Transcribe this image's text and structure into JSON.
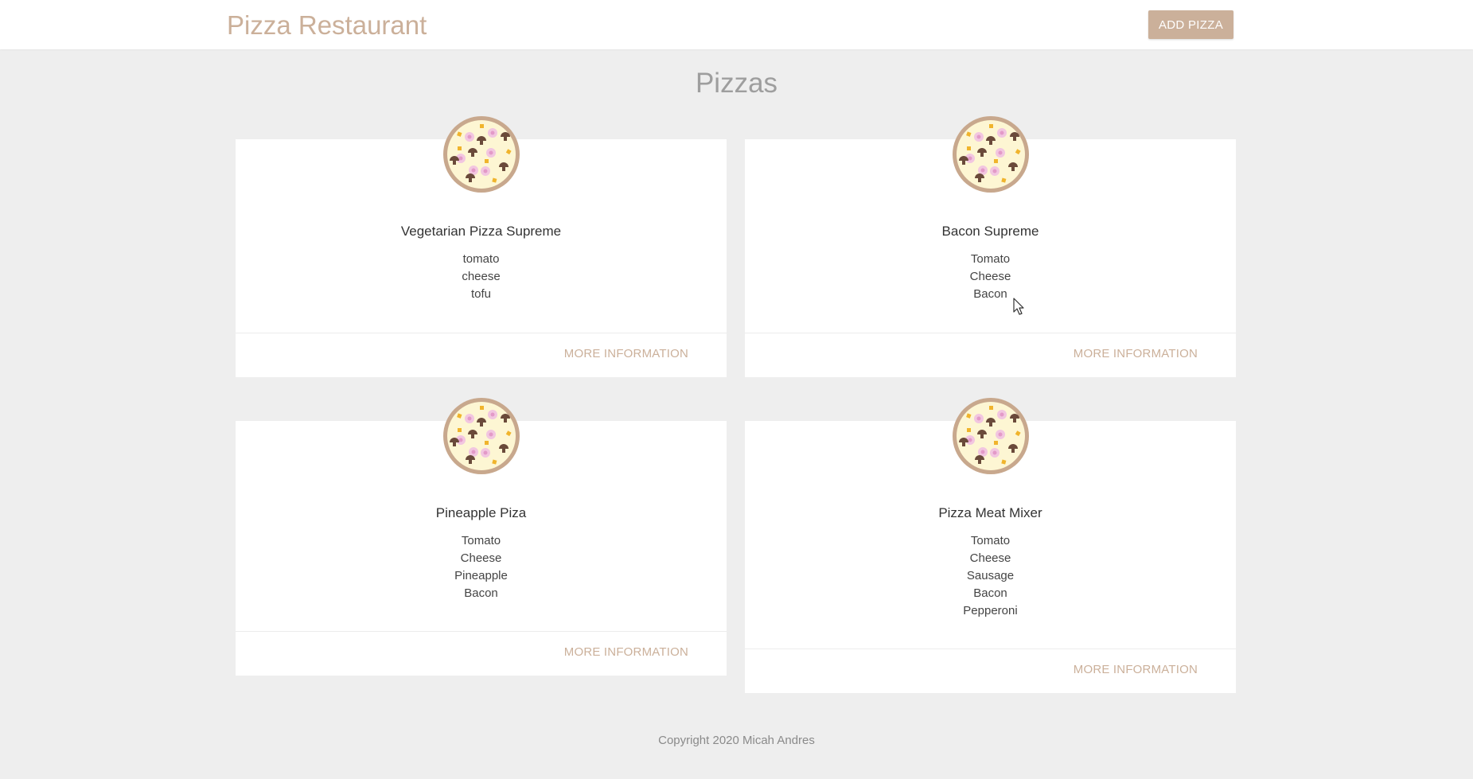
{
  "navbar": {
    "brand": "Pizza Restaurant",
    "add_button": "ADD PIZZA"
  },
  "page": {
    "title": "Pizzas"
  },
  "pizzas": [
    {
      "name": "Vegetarian Pizza Supreme",
      "ingredients": [
        "tomato",
        "cheese",
        "tofu"
      ],
      "action": "MORE INFORMATION"
    },
    {
      "name": "Bacon Supreme",
      "ingredients": [
        "Tomato",
        "Cheese",
        "Bacon"
      ],
      "action": "MORE INFORMATION"
    },
    {
      "name": "Pineapple Piza",
      "ingredients": [
        "Tomato",
        "Cheese",
        "Pineapple",
        "Bacon"
      ],
      "action": "MORE INFORMATION"
    },
    {
      "name": "Pizza Meat Mixer",
      "ingredients": [
        "Tomato",
        "Cheese",
        "Sausage",
        "Bacon",
        "Pepperoni"
      ],
      "action": "MORE INFORMATION"
    }
  ],
  "footer": {
    "copyright": "Copyright 2020 Micah Andres"
  },
  "colors": {
    "accent": "#cbb09a",
    "background": "#eeeeee",
    "card": "#ffffff",
    "title": "#9e9e9e"
  },
  "icons": {
    "pizza": "pizza-icon",
    "cursor": "mouse-cursor-icon"
  }
}
